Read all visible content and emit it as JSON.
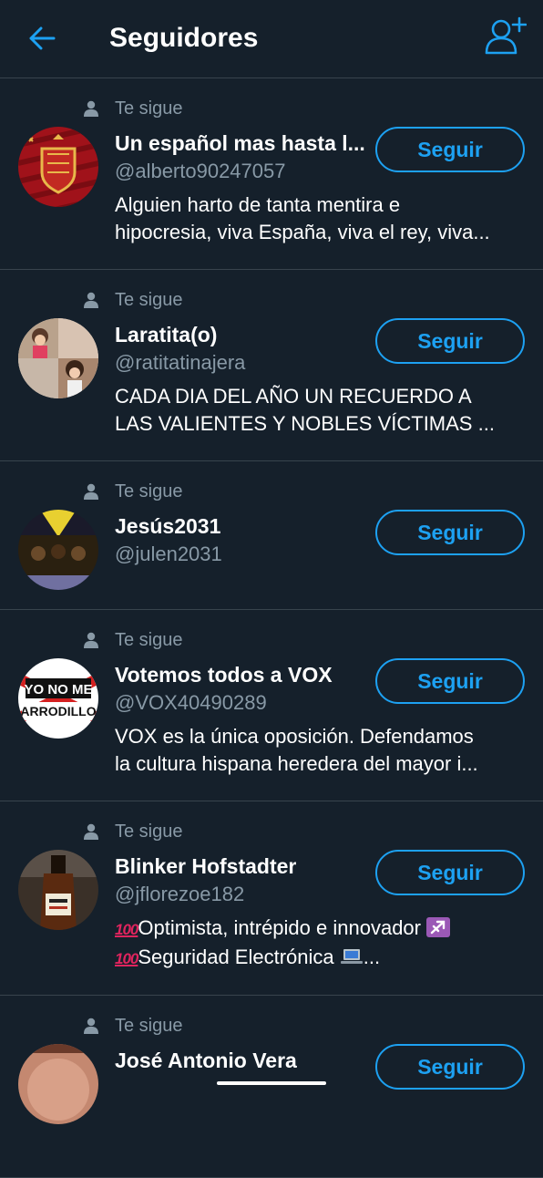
{
  "header": {
    "title": "Seguidores",
    "back_icon": "arrow-left-icon",
    "add_icon": "add-user-icon",
    "accent_color": "#1da1f2"
  },
  "followers": [
    {
      "follows_you": "Te sigue",
      "name": "Un español mas hasta l...",
      "handle": "@alberto90247057",
      "bio": [
        "Alguien harto de tanta mentira e",
        "hipocresia, viva España, viva el rey, viva..."
      ],
      "button": "Seguir"
    },
    {
      "follows_you": "Te sigue",
      "name": "Laratita(o)",
      "handle": "@ratitatinajera",
      "bio": [
        "CADA DIA DEL AÑO UN RECUERDO A",
        "LAS VALIENTES Y NOBLES VÍCTIMAS ..."
      ],
      "button": "Seguir"
    },
    {
      "follows_you": "Te sigue",
      "name": "Jesús2031",
      "handle": "@julen2031",
      "bio": [],
      "button": "Seguir"
    },
    {
      "follows_you": "Te sigue",
      "name": "Votemos todos a VOX",
      "handle": "@VOX40490289",
      "bio": [
        "VOX es la única oposición. Defendamos",
        "la cultura hispana heredera del mayor i..."
      ],
      "button": "Seguir",
      "avatar_text": [
        "YO NO ME",
        "ARRODILLO"
      ]
    },
    {
      "follows_you": "Te sigue",
      "name": "Blinker Hofstadter",
      "handle": "@jflorezoe182",
      "bio_parts": [
        {
          "emoji": "100",
          "text": "Optimista, intrépido e innovador "
        },
        {
          "emoji": "100",
          "text": "Seguridad Electrónica "
        }
      ],
      "bio_trailing": "...",
      "button": "Seguir"
    },
    {
      "follows_you": "Te sigue",
      "name": "José Antonio Vera",
      "button": "Seguir"
    }
  ]
}
